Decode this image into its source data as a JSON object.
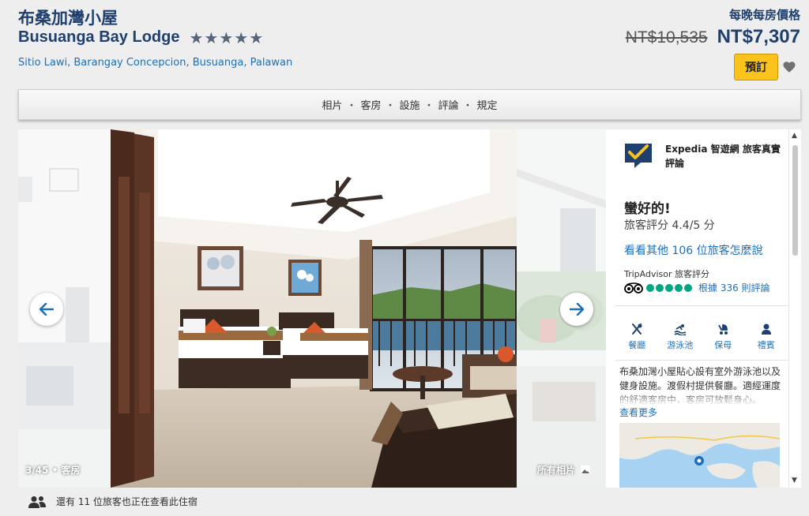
{
  "hotel": {
    "name_zh": "布桑加灣小屋",
    "name_en": "Busuanga Bay Lodge",
    "stars": 5,
    "address": "Sitio Lawi, Barangay Concepcion, Busuanga, Palawan"
  },
  "price": {
    "label": "每晚每房價格",
    "old": "NT$10,535",
    "new": "NT$7,307",
    "book_label": "預訂"
  },
  "nav": {
    "items": [
      "相片",
      "客房",
      "設施",
      "評論",
      "規定"
    ],
    "separator": "・"
  },
  "gallery": {
    "counter": "3/45 • 客房",
    "all_photos": "所有相片"
  },
  "review": {
    "provider": "Expedia 智遊網 旅客真實評論",
    "rating_word": "蠻好的!",
    "rating_score": "旅客評分 4.4/5 分",
    "reviews_link": "看看其他 106 位旅客怎麼說",
    "ta_label": "TripAdvisor 旅客評分",
    "ta_bubbles": 5,
    "ta_count": "根據 336 則評論"
  },
  "amenities": [
    {
      "label": "餐廳",
      "icon": "restaurant-icon"
    },
    {
      "label": "游泳池",
      "icon": "pool-icon"
    },
    {
      "label": "保母",
      "icon": "stroller-icon"
    },
    {
      "label": "禮賓",
      "icon": "concierge-icon"
    }
  ],
  "description": {
    "text": "布桑加灣小屋貼心設有室外游泳池以及健身設施。渡假村提供餐廳。適經運度的舒適客房中，客房可放鬆身心。",
    "see_more": "查看更多"
  },
  "footer": {
    "viewers": "還有 11 位旅客也正在查看此住宿"
  },
  "colors": {
    "brand_navy": "#1f3f6e",
    "link_blue": "#1e6fb8",
    "book_yellow": "#fcc31d",
    "tripadvisor_green": "#00a680"
  }
}
